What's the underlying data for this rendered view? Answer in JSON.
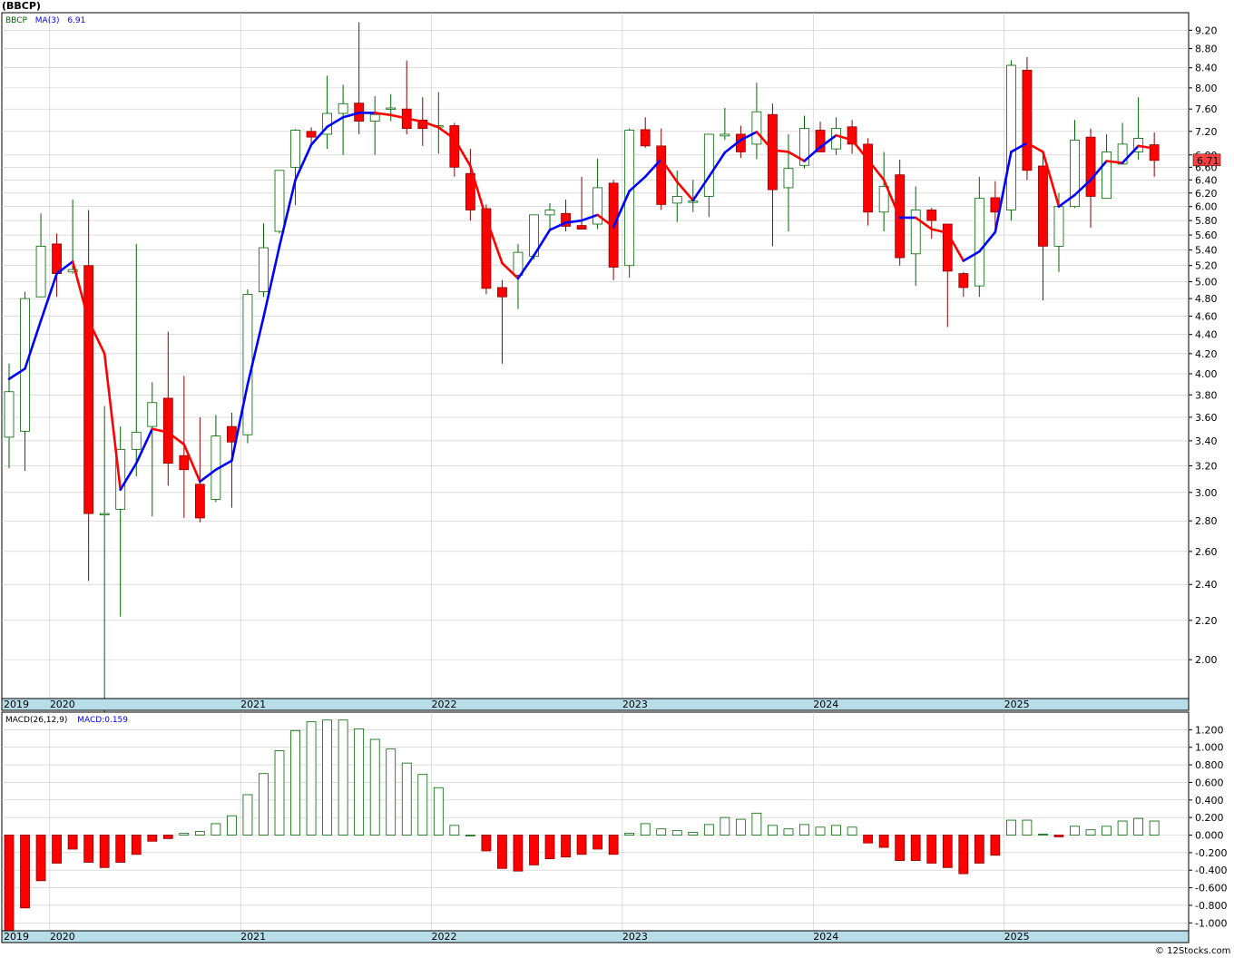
{
  "title": "(BBCP)",
  "watermark": "© 12Stocks.com",
  "price_legend": {
    "symbol": "BBCP",
    "ma_label": "MA(3)",
    "ma_value": "6.91"
  },
  "macd_legend": {
    "label": "MACD(26,12,9)",
    "value_label": "MACD:0.159"
  },
  "last_price_label": "6.71",
  "colors": {
    "up_candle_fill": "#ffffff",
    "up_wick": "#006400",
    "down_candle": "#ff0000",
    "ma_up": "#0000ff",
    "ma_down": "#ff0000",
    "macd_pos": "#006400",
    "macd_neg": "#ff0000",
    "year_band": "#b7dde8",
    "grid": "#c8c8c8"
  },
  "chart_data": [
    {
      "type": "candlestick",
      "title": "(BBCP)",
      "scale": "log",
      "ylim": [
        1.82,
        9.6
      ],
      "yticks": [
        "2.00",
        "2.20",
        "2.40",
        "2.60",
        "2.80",
        "3.00",
        "3.20",
        "3.40",
        "3.60",
        "3.80",
        "4.00",
        "4.20",
        "4.40",
        "4.60",
        "4.80",
        "5.00",
        "5.20",
        "5.40",
        "5.60",
        "5.80",
        "6.00",
        "6.20",
        "6.40",
        "6.60",
        "6.80",
        "7.20",
        "7.60",
        "8.00",
        "8.40",
        "8.80",
        "9.20"
      ],
      "x_year_labels": [
        {
          "label": "2019",
          "index": 0
        },
        {
          "label": "2020",
          "index": 3
        },
        {
          "label": "2021",
          "index": 15
        },
        {
          "label": "2022",
          "index": 27
        },
        {
          "label": "2023",
          "index": 39
        },
        {
          "label": "2024",
          "index": 51
        },
        {
          "label": "2025",
          "index": 63
        }
      ],
      "ohlc": [
        [
          3.43,
          4.1,
          3.18,
          3.83
        ],
        [
          3.48,
          4.88,
          3.16,
          4.8
        ],
        [
          4.82,
          5.9,
          4.82,
          5.45
        ],
        [
          5.48,
          5.62,
          4.82,
          5.1
        ],
        [
          5.12,
          6.1,
          5.1,
          5.15
        ],
        [
          5.2,
          5.95,
          2.42,
          2.85
        ],
        [
          2.85,
          3.7,
          1.75,
          2.85
        ],
        [
          2.88,
          3.52,
          2.22,
          3.33
        ],
        [
          3.33,
          5.48,
          3.12,
          3.47
        ],
        [
          3.52,
          3.92,
          2.83,
          3.73
        ],
        [
          3.77,
          4.43,
          3.05,
          3.22
        ],
        [
          3.28,
          3.98,
          2.82,
          3.17
        ],
        [
          3.06,
          3.6,
          2.79,
          2.82
        ],
        [
          2.95,
          3.62,
          2.93,
          3.44
        ],
        [
          3.52,
          3.64,
          2.89,
          3.39
        ],
        [
          3.45,
          4.91,
          3.38,
          4.85
        ],
        [
          4.88,
          5.76,
          4.82,
          5.43
        ],
        [
          5.65,
          6.3,
          5.62,
          6.55
        ],
        [
          6.6,
          7.24,
          6.02,
          7.22
        ],
        [
          7.2,
          7.27,
          6.95,
          7.1
        ],
        [
          7.15,
          8.24,
          6.9,
          7.52
        ],
        [
          7.52,
          8.06,
          6.8,
          7.7
        ],
        [
          7.71,
          9.38,
          7.15,
          7.38
        ],
        [
          7.38,
          7.84,
          6.8,
          7.5
        ],
        [
          7.6,
          7.88,
          7.38,
          7.62
        ],
        [
          7.6,
          8.55,
          7.15,
          7.25
        ],
        [
          7.4,
          7.82,
          6.95,
          7.25
        ],
        [
          7.28,
          7.92,
          6.82,
          7.3
        ],
        [
          7.3,
          7.35,
          6.45,
          6.6
        ],
        [
          6.5,
          6.9,
          5.8,
          5.95
        ],
        [
          5.97,
          6.03,
          4.85,
          4.92
        ],
        [
          4.93,
          5.02,
          4.1,
          4.82
        ],
        [
          5.08,
          5.48,
          4.68,
          5.37
        ],
        [
          5.32,
          5.85,
          5.28,
          5.88
        ],
        [
          5.88,
          6.05,
          5.68,
          5.95
        ],
        [
          5.9,
          6.1,
          5.65,
          5.72
        ],
        [
          5.73,
          6.45,
          5.68,
          5.68
        ],
        [
          5.75,
          6.74,
          5.68,
          6.28
        ],
        [
          6.35,
          6.4,
          5.02,
          5.18
        ],
        [
          5.2,
          7.25,
          5.05,
          7.22
        ],
        [
          7.23,
          7.45,
          6.92,
          6.95
        ],
        [
          6.95,
          7.25,
          5.95,
          6.03
        ],
        [
          6.05,
          6.55,
          5.78,
          6.15
        ],
        [
          6.08,
          6.4,
          5.92,
          6.08
        ],
        [
          6.15,
          7.15,
          5.85,
          7.15
        ],
        [
          7.12,
          7.62,
          7.05,
          7.15
        ],
        [
          7.15,
          7.3,
          6.75,
          6.85
        ],
        [
          6.98,
          8.1,
          6.73,
          7.55
        ],
        [
          7.5,
          7.7,
          5.45,
          6.25
        ],
        [
          6.28,
          7.15,
          5.65,
          6.58
        ],
        [
          6.63,
          7.48,
          6.58,
          7.25
        ],
        [
          7.22,
          7.37,
          6.9,
          6.85
        ],
        [
          6.9,
          7.45,
          6.8,
          7.25
        ],
        [
          7.28,
          7.4,
          6.82,
          6.98
        ],
        [
          6.98,
          7.08,
          5.73,
          5.92
        ],
        [
          5.92,
          6.85,
          5.65,
          6.3
        ],
        [
          6.48,
          6.72,
          5.2,
          5.3
        ],
        [
          5.35,
          6.3,
          4.95,
          5.95
        ],
        [
          5.95,
          5.98,
          5.55,
          5.8
        ],
        [
          5.75,
          5.7,
          4.48,
          5.13
        ],
        [
          5.1,
          5.12,
          4.82,
          4.93
        ],
        [
          4.95,
          6.45,
          4.82,
          6.12
        ],
        [
          6.13,
          6.38,
          5.62,
          5.92
        ],
        [
          5.95,
          8.55,
          5.8,
          8.45
        ],
        [
          8.35,
          8.62,
          6.4,
          6.55
        ],
        [
          6.62,
          6.85,
          4.78,
          5.45
        ],
        [
          5.45,
          6.2,
          5.12,
          6.0
        ],
        [
          6.0,
          7.4,
          5.98,
          7.05
        ],
        [
          7.1,
          7.25,
          5.7,
          6.15
        ],
        [
          6.12,
          7.15,
          6.12,
          6.85
        ],
        [
          6.65,
          7.35,
          6.65,
          6.98
        ],
        [
          6.85,
          7.82,
          6.72,
          7.08
        ],
        [
          6.97,
          7.18,
          6.45,
          6.71
        ]
      ],
      "ma": [
        {
          "name": "MA(3)",
          "from_index": 0,
          "values": [
            3.95,
            4.05,
            4.55,
            5.1,
            5.25,
            4.55,
            4.2,
            3.02,
            3.22,
            3.5,
            3.47,
            3.37,
            3.08,
            3.17,
            3.24,
            3.9,
            4.59,
            5.45,
            6.4,
            6.97,
            7.28,
            7.45,
            7.53,
            7.53,
            7.49,
            7.43,
            7.37,
            7.27,
            7.07,
            6.62,
            5.83,
            5.23,
            5.04,
            5.33,
            5.67,
            5.77,
            5.8,
            5.88,
            5.71,
            6.23,
            6.45,
            6.73,
            6.37,
            6.09,
            6.45,
            6.84,
            7.05,
            7.19,
            6.88,
            6.85,
            6.7,
            6.93,
            7.13,
            7.05,
            6.72,
            6.4,
            5.84,
            5.84,
            5.68,
            5.63,
            5.26,
            5.38,
            5.64,
            6.85,
            7.0,
            6.85,
            6.0,
            6.17,
            6.4,
            6.7,
            6.67,
            6.95,
            6.91
          ]
        }
      ]
    },
    {
      "type": "bar",
      "title": "MACD(26,12,9)",
      "ylim": [
        -1.09,
        1.4
      ],
      "yticks": [
        "-1.000",
        "-0.800",
        "-0.600",
        "-0.400",
        "-0.200",
        "0.000",
        "0.200",
        "0.400",
        "0.600",
        "0.800",
        "1.000",
        "1.200"
      ],
      "values": [
        -1.15,
        -0.83,
        -0.52,
        -0.32,
        -0.16,
        -0.31,
        -0.37,
        -0.31,
        -0.22,
        -0.07,
        -0.04,
        0.02,
        0.04,
        0.13,
        0.22,
        0.46,
        0.7,
        0.96,
        1.19,
        1.29,
        1.31,
        1.31,
        1.21,
        1.09,
        0.98,
        0.82,
        0.69,
        0.54,
        0.11,
        0.0,
        -0.18,
        -0.38,
        -0.41,
        -0.34,
        -0.27,
        -0.25,
        -0.22,
        -0.16,
        -0.22,
        0.02,
        0.13,
        0.07,
        0.05,
        0.03,
        0.12,
        0.2,
        0.18,
        0.25,
        0.11,
        0.07,
        0.12,
        0.09,
        0.11,
        0.09,
        -0.09,
        -0.14,
        -0.29,
        -0.29,
        -0.32,
        -0.37,
        -0.44,
        -0.32,
        -0.23,
        0.17,
        0.17,
        0.01,
        -0.02,
        0.1,
        0.06,
        0.1,
        0.16,
        0.19,
        0.16
      ]
    }
  ]
}
